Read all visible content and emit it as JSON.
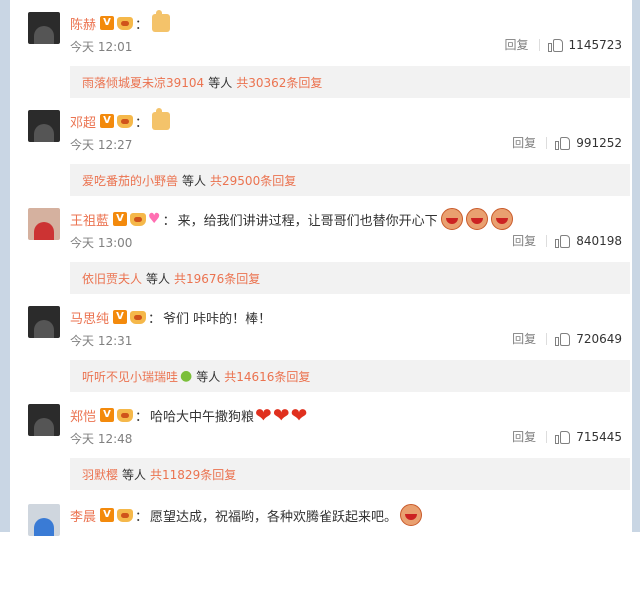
{
  "comments": [
    {
      "username": "陈赫",
      "emoji_desc": "thumbs-up",
      "text": "",
      "time": "今天 12:01",
      "reply_label": "回复",
      "likes": "1145723",
      "sub": {
        "user": "雨落倾城夏未凉39104",
        "mid": "等人",
        "count": "共30362条回复"
      }
    },
    {
      "username": "邓超",
      "emoji_desc": "thumbs-up",
      "text": "",
      "time": "今天 12:27",
      "reply_label": "回复",
      "likes": "991252",
      "sub": {
        "user": "爱吃番茄的小野兽",
        "mid": "等人",
        "count": "共29500条回复"
      }
    },
    {
      "username": "王祖藍",
      "emoji_desc": "laughing-faces",
      "text": "来，给我们讲讲过程，让哥哥们也替你开心下",
      "time": "今天 13:00",
      "reply_label": "回复",
      "likes": "840198",
      "sub": {
        "user": "依旧贾夫人",
        "mid": "等人",
        "count": "共19676条回复"
      }
    },
    {
      "username": "马思纯",
      "emoji_desc": "",
      "text": "爷们 咔咔的！棒！",
      "time": "今天 12:31",
      "reply_label": "回复",
      "likes": "720649",
      "sub": {
        "user": "听听不见小瑞瑞哇",
        "mid": "等人",
        "count": "共14616条回复"
      }
    },
    {
      "username": "郑恺",
      "emoji_desc": "hearts",
      "text": "哈哈大中午撒狗粮",
      "time": "今天 12:48",
      "reply_label": "回复",
      "likes": "715445",
      "sub": {
        "user": "羽默樱",
        "mid": "等人",
        "count": "共11829条回复"
      }
    },
    {
      "username": "李晨",
      "emoji_desc": "laughing-face",
      "text": "愿望达成，祝福哟，各种欢腾雀跃起来吧。"
    }
  ],
  "colors": {
    "accent": "#eb7350",
    "reply_bg": "#f2f2f2",
    "muted": "#808080"
  },
  "icons": {
    "like": "like-thumb-icon",
    "vip": "v-badge-icon",
    "crown": "member-crown-icon"
  }
}
